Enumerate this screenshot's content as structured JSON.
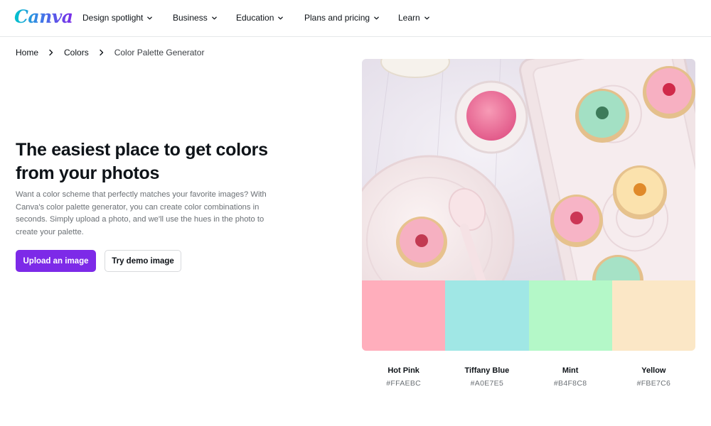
{
  "brand": {
    "logo_text": "Canva"
  },
  "nav": {
    "items": [
      {
        "label": "Design spotlight"
      },
      {
        "label": "Business"
      },
      {
        "label": "Education"
      },
      {
        "label": "Plans and pricing"
      },
      {
        "label": "Learn"
      }
    ]
  },
  "breadcrumb": {
    "items": [
      "Home",
      "Colors",
      "Color Palette Generator"
    ]
  },
  "hero": {
    "title": "The easiest place to get colors from your photos",
    "description": "Want a color scheme that perfectly matches your favorite images? With Canva's color palette generator, you can create color combinations in seconds. Simply upload a photo, and we'll use the hues in the photo to create your palette.",
    "upload_label": "Upload an image",
    "demo_label": "Try demo image"
  },
  "palette": {
    "swatches": [
      {
        "name": "Hot Pink",
        "hex": "#FFAEBC"
      },
      {
        "name": "Tiffany Blue",
        "hex": "#A0E7E5"
      },
      {
        "name": "Mint",
        "hex": "#B4F8C8"
      },
      {
        "name": "Yellow",
        "hex": "#FBE7C6"
      }
    ]
  },
  "colors": {
    "accent": "#7d2ae8",
    "text": "#0e1318",
    "muted": "#6b7075"
  }
}
